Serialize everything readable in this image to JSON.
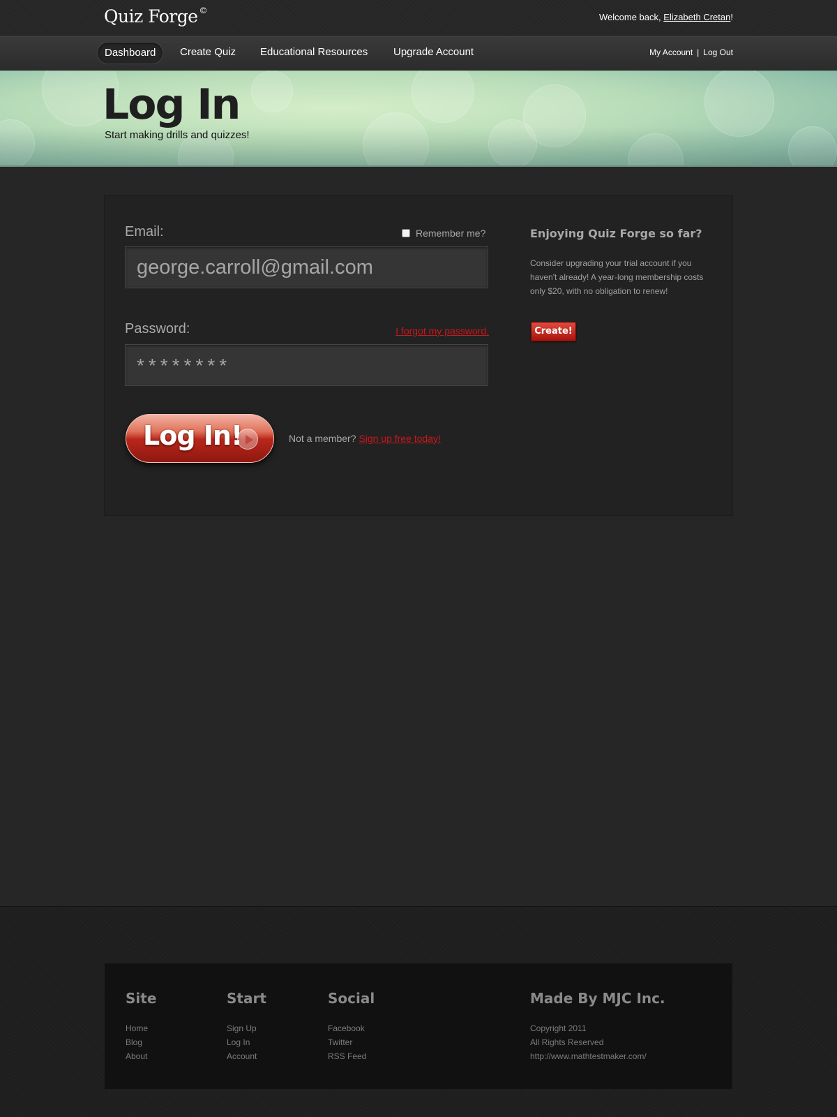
{
  "header": {
    "logo": "Quiz Forge",
    "logo_mark": "©",
    "welcome_prefix": "Welcome back, ",
    "user_name": "Elizabeth Cretan",
    "welcome_suffix": "!"
  },
  "nav": {
    "items": [
      {
        "label": "Dashboard",
        "active": true
      },
      {
        "label": "Create Quiz"
      },
      {
        "label": "Educational Resources"
      },
      {
        "label": "Upgrade Account"
      }
    ],
    "my_account": "My Account",
    "separator": "|",
    "log_out": "Log Out"
  },
  "hero": {
    "title": "Log In",
    "subtitle": "Start making drills and quizzes!"
  },
  "login_form": {
    "email_label": "Email:",
    "email_value": "george.carroll@gmail.com",
    "remember_label": "Remember me?",
    "remember_checked": false,
    "password_label": "Password:",
    "password_value": "********",
    "forgot_link": "I forgot my password.",
    "submit_label": "Log In!",
    "not_member_text": "Not a member? ",
    "signup_link": "Sign up free today!"
  },
  "sidebar": {
    "title": "Enjoying Quiz Forge so far?",
    "text": "Consider upgrading your trial account if you haven't already! A year-long membership costs only $20, with no obligation to renew!",
    "button_label": "Create!"
  },
  "footer": {
    "columns": [
      {
        "title": "Site",
        "links": [
          "Home",
          "Blog",
          "About"
        ]
      },
      {
        "title": "Start",
        "links": [
          "Sign Up",
          "Log In",
          "Account"
        ]
      },
      {
        "title": "Social",
        "links": [
          "Facebook",
          "Twitter",
          "RSS Feed"
        ]
      },
      {
        "title": "Made By MJC Inc.",
        "links": [
          "Copyright 2011",
          "All Rights Reserved",
          "http://www.mathtestmaker.com/"
        ]
      }
    ]
  },
  "colors": {
    "background": "#262626",
    "accent_red": "#c9181c",
    "hero_green": "#c8e6c0"
  }
}
